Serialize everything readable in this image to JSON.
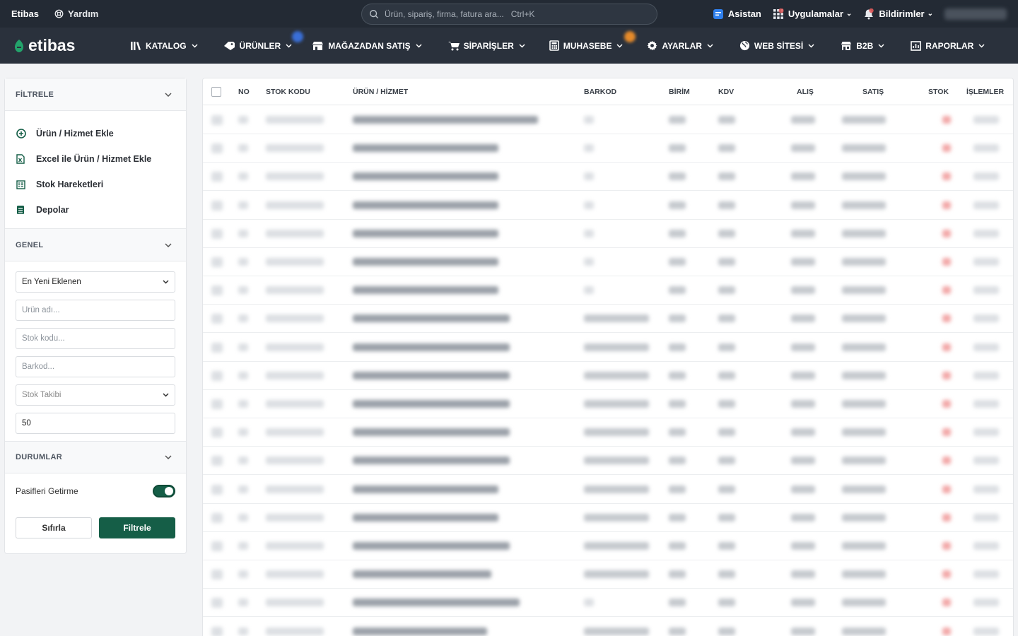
{
  "topbar": {
    "brand": "Etibas",
    "help": "Yardım",
    "search_placeholder": "Ürün, sipariş, firma, fatura ara...",
    "search_shortcut": "Ctrl+K",
    "assistant": "Asistan",
    "apps": "Uygulamalar",
    "notifications": "Bildirimler"
  },
  "nav": {
    "logo": "etibas",
    "items": [
      "KATALOG",
      "ÜRÜNLER",
      "MAĞAZADAN SATIŞ",
      "SİPARİŞLER",
      "MUHASEBE",
      "AYARLAR",
      "WEB SİTESİ",
      "B2B",
      "RAPORLAR"
    ]
  },
  "sidebar": {
    "filter_title": "FİLTRELE",
    "menu": [
      "Ürün / Hizmet Ekle",
      "Excel ile Ürün / Hizmet Ekle",
      "Stok Hareketleri",
      "Depolar"
    ],
    "general_title": "GENEL",
    "sort_value": "En Yeni Eklenen",
    "name_placeholder": "Ürün adı...",
    "code_placeholder": "Stok kodu...",
    "barcode_placeholder": "Barkod...",
    "stock_tracking": "Stok Takibi",
    "page_size": "50",
    "status_title": "DURUMLAR",
    "passive_label": "Pasifleri Getirme",
    "reset_label": "Sıfırla",
    "apply_label": "Filtrele"
  },
  "table": {
    "headers": {
      "no": "NO",
      "stock_code": "STOK KODU",
      "product": "ÜRÜN / HİZMET",
      "barcode": "BARKOD",
      "unit": "BİRİM",
      "vat": "KDV",
      "purchase": "ALIŞ",
      "sale": "SATIŞ",
      "stock": "STOK",
      "actions": "İŞLEMLER"
    }
  },
  "colors": {
    "topbar": "#232a34",
    "navbar": "#2a313c",
    "accent": "#155e47",
    "logo_green": "#23a36b"
  }
}
